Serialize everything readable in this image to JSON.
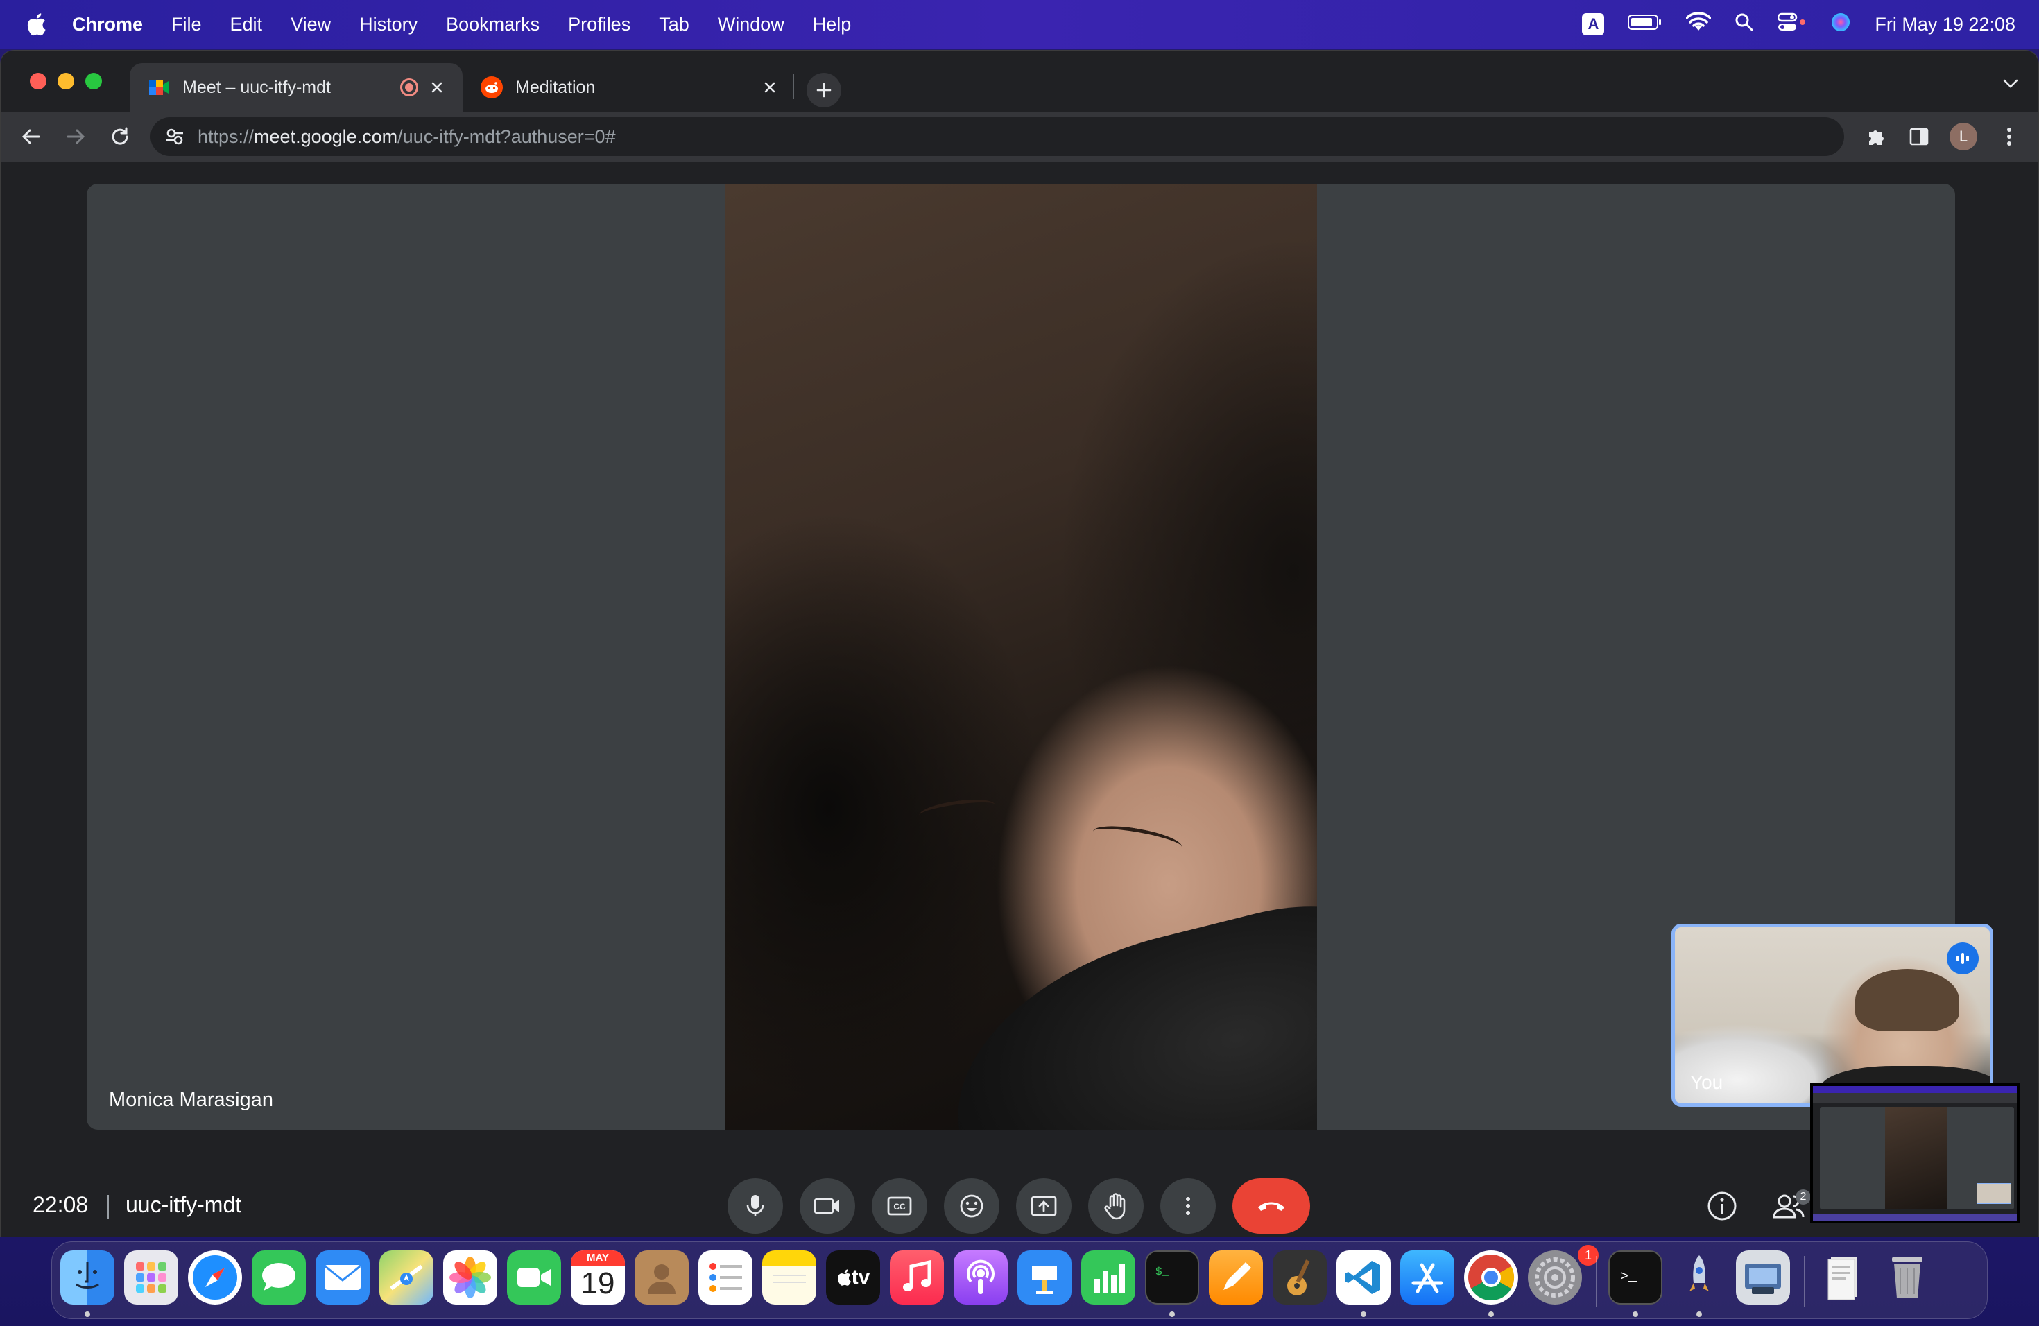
{
  "menubar": {
    "app_name": "Chrome",
    "menus": [
      "File",
      "Edit",
      "View",
      "History",
      "Bookmarks",
      "Profiles",
      "Tab",
      "Window",
      "Help"
    ],
    "input_source": "A",
    "datetime": "Fri May 19  22:08"
  },
  "browser": {
    "tabs": [
      {
        "title": "Meet – uuc-itfy-mdt",
        "active": true,
        "recording": true
      },
      {
        "title": "Meditation",
        "active": false
      }
    ],
    "url": {
      "scheme": "https://",
      "host": "meet.google.com",
      "path": "/uuc-itfy-mdt?authuser=0#"
    },
    "profile_initial": "L"
  },
  "meet": {
    "participant_name": "Monica Marasigan",
    "self_label": "You",
    "clock": "22:08",
    "meeting_code": "uuc-itfy-mdt",
    "participant_count": "2",
    "controls": [
      "microphone",
      "camera",
      "captions",
      "reactions",
      "present-screen",
      "raise-hand",
      "more-options",
      "leave-call"
    ],
    "right_controls": [
      "meeting-details",
      "people"
    ],
    "colors": {
      "end_call": "#ea4335",
      "speaking": "#1a73e8",
      "self_border": "#8ab4f8"
    }
  },
  "dock": {
    "calendar_month": "MAY",
    "calendar_day": "19",
    "tv_label": "tv",
    "settings_badge": "1",
    "apps": [
      "Finder",
      "Launchpad",
      "Safari",
      "Messages",
      "Mail",
      "Maps",
      "Photos",
      "FaceTime",
      "Calendar",
      "Contacts",
      "Reminders",
      "Notes",
      "TV",
      "Music",
      "Podcasts",
      "Keynote",
      "Numbers",
      "Terminal",
      "Pages",
      "GarageBand",
      "Visual Studio Code",
      "App Store",
      "Google Chrome",
      "System Settings",
      "Terminal",
      "Instruments",
      "Preview",
      "Downloads",
      "Trash"
    ]
  }
}
